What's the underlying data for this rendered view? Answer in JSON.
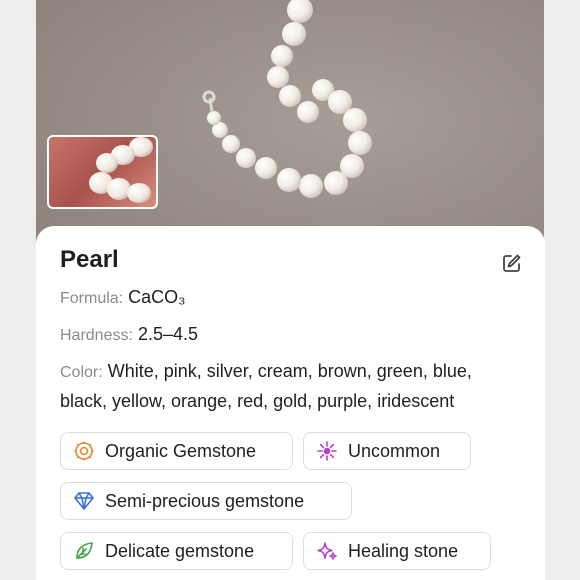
{
  "mineral": {
    "name": "Pearl",
    "formula_label": "Formula:",
    "formula_value": "CaCO₃",
    "hardness_label": "Hardness:",
    "hardness_value": "2.5–4.5",
    "color_label": "Color:",
    "color_value": "White, pink, silver, cream, brown, green, blue, black, yellow, orange, red, gold, purple, iridescent"
  },
  "tags": [
    {
      "label": "Organic Gemstone",
      "icon": "organic-icon",
      "color": "#e0892e"
    },
    {
      "label": "Uncommon",
      "icon": "sparkle-burst-icon",
      "color": "#b43fd1"
    },
    {
      "label": "Semi-precious gemstone",
      "icon": "diamond-icon",
      "color": "#3d6fd8"
    },
    {
      "label": "Delicate gemstone",
      "icon": "leaf-icon",
      "color": "#3fa64a"
    },
    {
      "label": "Healing stone",
      "icon": "sparkles-icon",
      "color": "#b43fd1"
    }
  ],
  "icons": {
    "edit": "edit-icon"
  }
}
